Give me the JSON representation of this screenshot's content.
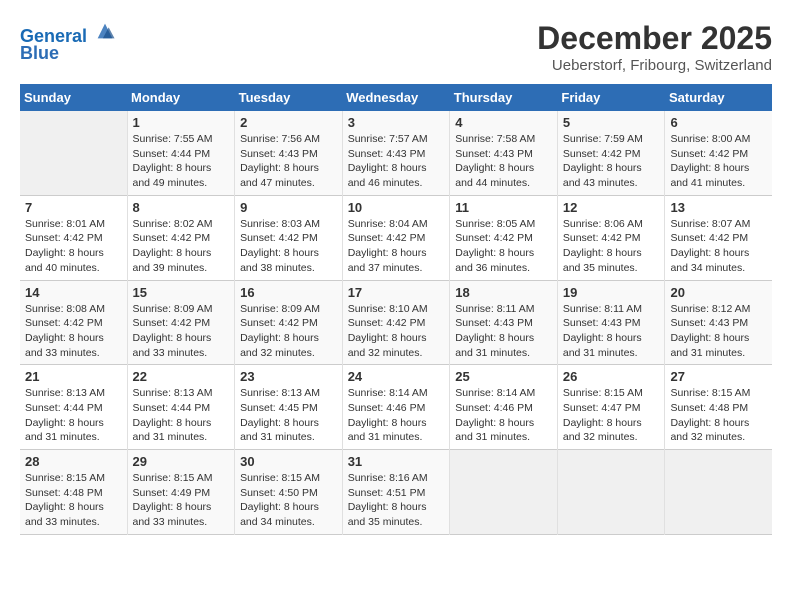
{
  "logo": {
    "line1": "General",
    "line2": "Blue"
  },
  "title": "December 2025",
  "subtitle": "Ueberstorf, Fribourg, Switzerland",
  "weekdays": [
    "Sunday",
    "Monday",
    "Tuesday",
    "Wednesday",
    "Thursday",
    "Friday",
    "Saturday"
  ],
  "weeks": [
    [
      {
        "day": "",
        "info": ""
      },
      {
        "day": "1",
        "info": "Sunrise: 7:55 AM\nSunset: 4:44 PM\nDaylight: 8 hours\nand 49 minutes."
      },
      {
        "day": "2",
        "info": "Sunrise: 7:56 AM\nSunset: 4:43 PM\nDaylight: 8 hours\nand 47 minutes."
      },
      {
        "day": "3",
        "info": "Sunrise: 7:57 AM\nSunset: 4:43 PM\nDaylight: 8 hours\nand 46 minutes."
      },
      {
        "day": "4",
        "info": "Sunrise: 7:58 AM\nSunset: 4:43 PM\nDaylight: 8 hours\nand 44 minutes."
      },
      {
        "day": "5",
        "info": "Sunrise: 7:59 AM\nSunset: 4:42 PM\nDaylight: 8 hours\nand 43 minutes."
      },
      {
        "day": "6",
        "info": "Sunrise: 8:00 AM\nSunset: 4:42 PM\nDaylight: 8 hours\nand 41 minutes."
      }
    ],
    [
      {
        "day": "7",
        "info": "Sunrise: 8:01 AM\nSunset: 4:42 PM\nDaylight: 8 hours\nand 40 minutes."
      },
      {
        "day": "8",
        "info": "Sunrise: 8:02 AM\nSunset: 4:42 PM\nDaylight: 8 hours\nand 39 minutes."
      },
      {
        "day": "9",
        "info": "Sunrise: 8:03 AM\nSunset: 4:42 PM\nDaylight: 8 hours\nand 38 minutes."
      },
      {
        "day": "10",
        "info": "Sunrise: 8:04 AM\nSunset: 4:42 PM\nDaylight: 8 hours\nand 37 minutes."
      },
      {
        "day": "11",
        "info": "Sunrise: 8:05 AM\nSunset: 4:42 PM\nDaylight: 8 hours\nand 36 minutes."
      },
      {
        "day": "12",
        "info": "Sunrise: 8:06 AM\nSunset: 4:42 PM\nDaylight: 8 hours\nand 35 minutes."
      },
      {
        "day": "13",
        "info": "Sunrise: 8:07 AM\nSunset: 4:42 PM\nDaylight: 8 hours\nand 34 minutes."
      }
    ],
    [
      {
        "day": "14",
        "info": "Sunrise: 8:08 AM\nSunset: 4:42 PM\nDaylight: 8 hours\nand 33 minutes."
      },
      {
        "day": "15",
        "info": "Sunrise: 8:09 AM\nSunset: 4:42 PM\nDaylight: 8 hours\nand 33 minutes."
      },
      {
        "day": "16",
        "info": "Sunrise: 8:09 AM\nSunset: 4:42 PM\nDaylight: 8 hours\nand 32 minutes."
      },
      {
        "day": "17",
        "info": "Sunrise: 8:10 AM\nSunset: 4:42 PM\nDaylight: 8 hours\nand 32 minutes."
      },
      {
        "day": "18",
        "info": "Sunrise: 8:11 AM\nSunset: 4:43 PM\nDaylight: 8 hours\nand 31 minutes."
      },
      {
        "day": "19",
        "info": "Sunrise: 8:11 AM\nSunset: 4:43 PM\nDaylight: 8 hours\nand 31 minutes."
      },
      {
        "day": "20",
        "info": "Sunrise: 8:12 AM\nSunset: 4:43 PM\nDaylight: 8 hours\nand 31 minutes."
      }
    ],
    [
      {
        "day": "21",
        "info": "Sunrise: 8:13 AM\nSunset: 4:44 PM\nDaylight: 8 hours\nand 31 minutes."
      },
      {
        "day": "22",
        "info": "Sunrise: 8:13 AM\nSunset: 4:44 PM\nDaylight: 8 hours\nand 31 minutes."
      },
      {
        "day": "23",
        "info": "Sunrise: 8:13 AM\nSunset: 4:45 PM\nDaylight: 8 hours\nand 31 minutes."
      },
      {
        "day": "24",
        "info": "Sunrise: 8:14 AM\nSunset: 4:46 PM\nDaylight: 8 hours\nand 31 minutes."
      },
      {
        "day": "25",
        "info": "Sunrise: 8:14 AM\nSunset: 4:46 PM\nDaylight: 8 hours\nand 31 minutes."
      },
      {
        "day": "26",
        "info": "Sunrise: 8:15 AM\nSunset: 4:47 PM\nDaylight: 8 hours\nand 32 minutes."
      },
      {
        "day": "27",
        "info": "Sunrise: 8:15 AM\nSunset: 4:48 PM\nDaylight: 8 hours\nand 32 minutes."
      }
    ],
    [
      {
        "day": "28",
        "info": "Sunrise: 8:15 AM\nSunset: 4:48 PM\nDaylight: 8 hours\nand 33 minutes."
      },
      {
        "day": "29",
        "info": "Sunrise: 8:15 AM\nSunset: 4:49 PM\nDaylight: 8 hours\nand 33 minutes."
      },
      {
        "day": "30",
        "info": "Sunrise: 8:15 AM\nSunset: 4:50 PM\nDaylight: 8 hours\nand 34 minutes."
      },
      {
        "day": "31",
        "info": "Sunrise: 8:16 AM\nSunset: 4:51 PM\nDaylight: 8 hours\nand 35 minutes."
      },
      {
        "day": "",
        "info": ""
      },
      {
        "day": "",
        "info": ""
      },
      {
        "day": "",
        "info": ""
      }
    ]
  ]
}
